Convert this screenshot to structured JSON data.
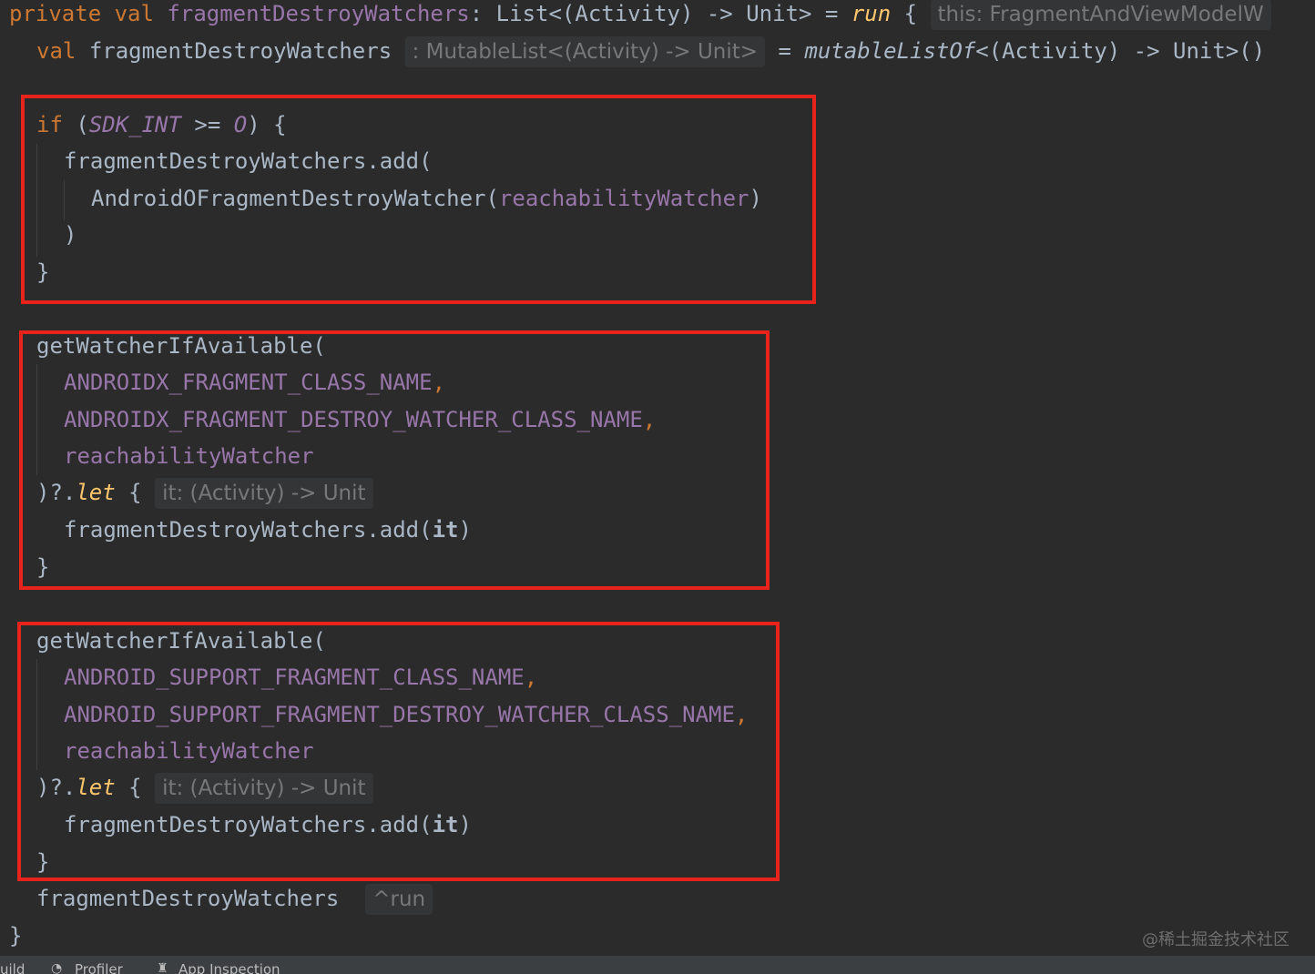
{
  "code": {
    "l1": {
      "private": "private",
      "val": "val",
      "name": "fragmentDestroyWatchers",
      "colon": ": ",
      "type": "List<(Activity) -> Unit>",
      "eq": " = ",
      "run": "run",
      "brace": " {",
      "hint": "this: FragmentAndViewModelW"
    },
    "l2": {
      "val": "val",
      "name": "fragmentDestroyWatchers",
      "hint": ": MutableList<(Activity) -> Unit>",
      "eq": "= ",
      "fn": "mutableListOf",
      "rest": "<(Activity) -> Unit>()"
    },
    "b1": {
      "if": "if",
      "open": " (",
      "sdk": "SDK_INT",
      "op": " >= ",
      "o": "O",
      "close": ") {",
      "add": "fragmentDestroyWatchers.add(",
      "watcher": "AndroidOFragmentDestroyWatcher(",
      "arg": "reachabilityWatcher",
      "paren": ")",
      "close_paren": ")",
      "close_brace": "}"
    },
    "b2": {
      "call": "getWatcherIfAvailable(",
      "arg1": "ANDROIDX_FRAGMENT_CLASS_NAME",
      "arg2": "ANDROIDX_FRAGMENT_DESTROY_WATCHER_CLASS_NAME",
      "comma": ",",
      "arg3": "reachabilityWatcher",
      "let_pre": ")?.",
      "let": "let",
      "let_brace": " {",
      "hint": "it: (Activity) -> Unit",
      "add": "fragmentDestroyWatchers.add(",
      "it": "it",
      "add_close": ")",
      "close_brace": "}"
    },
    "b3": {
      "call": "getWatcherIfAvailable(",
      "arg1": "ANDROID_SUPPORT_FRAGMENT_CLASS_NAME",
      "arg2": "ANDROID_SUPPORT_FRAGMENT_DESTROY_WATCHER_CLASS_NAME",
      "comma": ",",
      "arg3": "reachabilityWatcher",
      "let_pre": ")?.",
      "let": "let",
      "let_brace": " {",
      "hint": "it: (Activity) -> Unit",
      "add": "fragmentDestroyWatchers.add(",
      "it": "it",
      "add_close": ")",
      "close_brace": "}"
    },
    "end": {
      "name": "fragmentDestroyWatchers",
      "hint": "^run",
      "close": "}"
    }
  },
  "status": {
    "build": "uild",
    "profiler": "Profiler",
    "inspection": "App Inspection"
  },
  "watermark": "@稀土掘金技术社区",
  "colors": {
    "highlight_box": "#e8231b",
    "keyword": "#cc7832",
    "property": "#9876aa",
    "function": "#ffc66d"
  }
}
